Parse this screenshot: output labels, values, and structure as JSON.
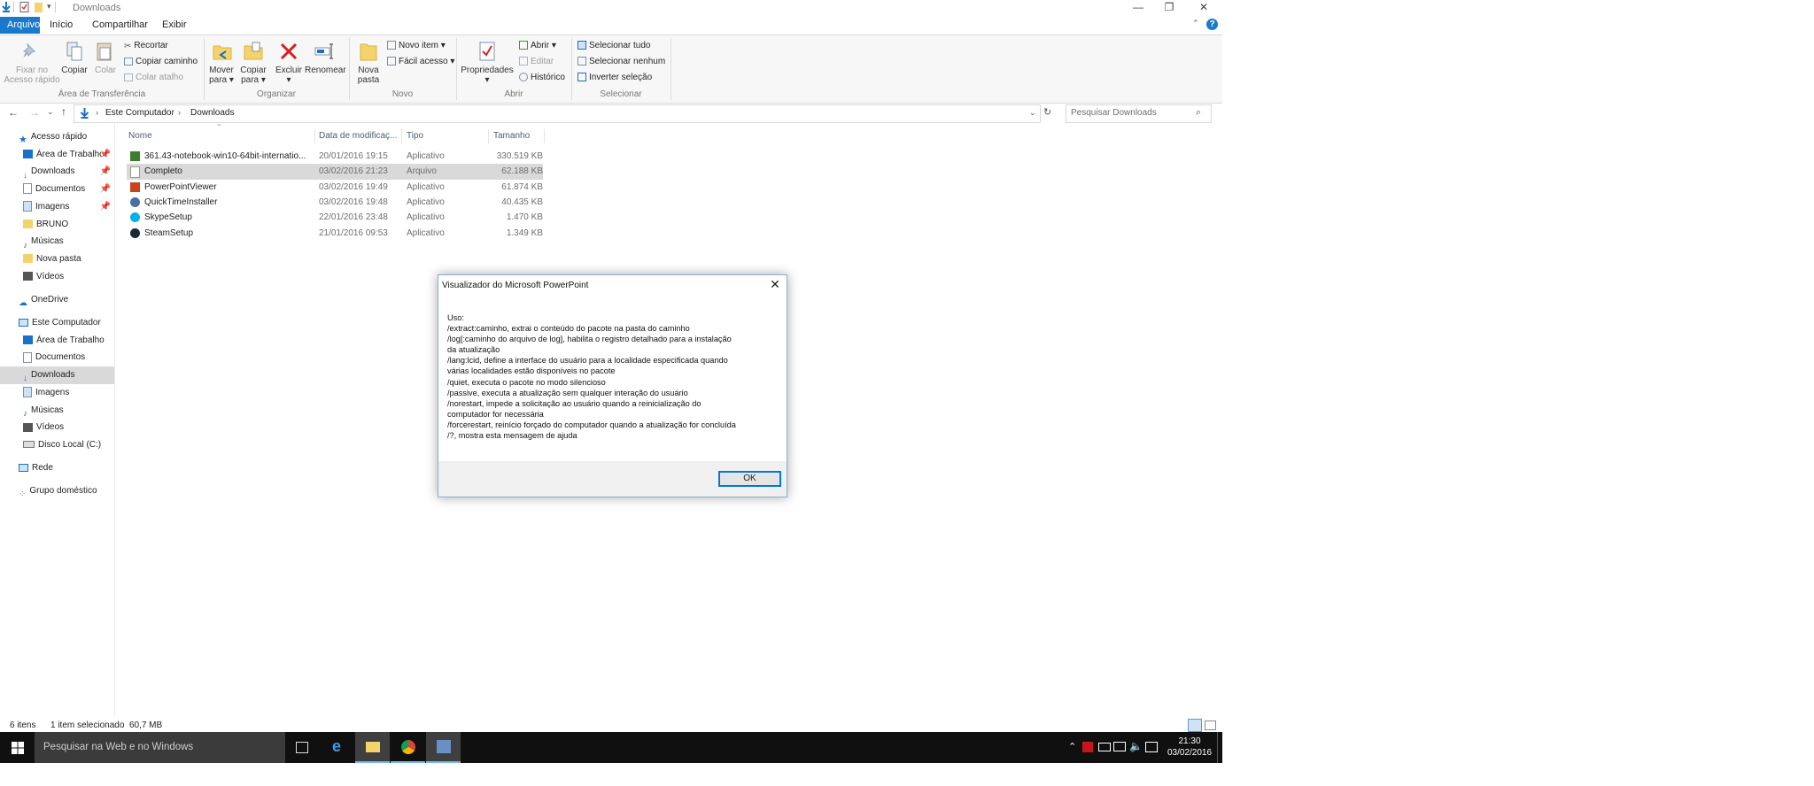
{
  "window": {
    "title": "Downloads",
    "controls": [
      "minimize",
      "restore",
      "close"
    ]
  },
  "menu_tabs": [
    "Arquivo",
    "Início",
    "Compartilhar",
    "Exibir"
  ],
  "ribbon": {
    "clipboard": {
      "group_label": "Área de Transferência",
      "pin_label_1": "Fixar no",
      "pin_label_2": "Acesso rápido",
      "copy": "Copiar",
      "paste": "Colar",
      "cut": "Recortar",
      "copy_path": "Copiar caminho",
      "paste_shortcut": "Colar atalho"
    },
    "organize": {
      "group_label": "Organizar",
      "move_1": "Mover",
      "move_2": "para",
      "copy_1": "Copiar",
      "copy_2": "para",
      "delete": "Excluir",
      "rename": "Renomear"
    },
    "new": {
      "group_label": "Novo",
      "new_folder_1": "Nova",
      "new_folder_2": "pasta",
      "new_item": "Novo item",
      "easy_access": "Fácil acesso"
    },
    "open": {
      "group_label": "Abrir",
      "properties": "Propriedades",
      "open": "Abrir",
      "edit": "Editar",
      "history": "Histórico"
    },
    "select": {
      "group_label": "Selecionar",
      "select_all": "Selecionar tudo",
      "select_none": "Selecionar nenhum",
      "invert": "Inverter seleção"
    }
  },
  "address": {
    "crumb_1": "Este Computador",
    "crumb_2": "Downloads",
    "search_placeholder": "Pesquisar Downloads"
  },
  "nav_pane": {
    "quick_access": "Acesso rápido",
    "qa_items": [
      "Área de Trabalho",
      "Downloads",
      "Documentos",
      "Imagens",
      "BRUNO",
      "Músicas",
      "Nova pasta",
      "Vídeos"
    ],
    "onedrive": "OneDrive",
    "this_pc": "Este Computador",
    "pc_items": [
      "Área de Trabalho",
      "Documentos",
      "Downloads",
      "Imagens",
      "Músicas",
      "Vídeos",
      "Disco Local (C:)"
    ],
    "network": "Rede",
    "homegroup": "Grupo doméstico"
  },
  "file_columns": [
    "Nome",
    "Data de modificaç...",
    "Tipo",
    "Tamanho"
  ],
  "files": [
    {
      "name": "361.43-notebook-win10-64bit-internatio...",
      "date": "20/01/2016 19:15",
      "type": "Aplicativo",
      "size": "330.519 KB"
    },
    {
      "name": "Completo",
      "date": "03/02/2016 21:23",
      "type": "Arquivo",
      "size": "62.188 KB"
    },
    {
      "name": "PowerPointViewer",
      "date": "03/02/2016 19:49",
      "type": "Aplicativo",
      "size": "61.874 KB"
    },
    {
      "name": "QuickTimeInstaller",
      "date": "03/02/2016 19:48",
      "type": "Aplicativo",
      "size": "40.435 KB"
    },
    {
      "name": "SkypeSetup",
      "date": "22/01/2016 23:48",
      "type": "Aplicativo",
      "size": "1.470 KB"
    },
    {
      "name": "SteamSetup",
      "date": "21/01/2016 09:53",
      "type": "Aplicativo",
      "size": "1.349 KB"
    }
  ],
  "status": {
    "items": "6 itens",
    "selected": "1 item selecionado  60,7 MB"
  },
  "dialog": {
    "title": "Visualizador do Microsoft PowerPoint",
    "body_lines": [
      "Uso:",
      "/extract:caminho, extrai o conteúdo do pacote na pasta do caminho",
      "/log[:caminho do arquivo de log], habilita o registro detalhado para a instalação",
      "da atualização",
      "/lang:lcid, define a interface do usuário para a localidade especificada quando",
      "várias localidades estão disponíveis no pacote",
      "/quiet, executa o pacote no modo silencioso",
      "/passive, executa a atualização sem qualquer interação do usuário",
      "/norestart, impede a solicitação ao usuário quando a reinicialização do",
      "computador for necessária",
      "/forcerestart, reinício forçado do computador quando a atualização for concluída",
      "/?, mostra esta mensagem de ajuda"
    ],
    "ok": "OK"
  },
  "taskbar": {
    "search_placeholder": "Pesquisar na Web e no Windows",
    "time": "21:30",
    "date": "03/02/2016"
  },
  "colors": {
    "accent": "#1979ca",
    "selection": "#d9d9d9",
    "taskbar": "#101010",
    "folder": "#f5d36b"
  }
}
